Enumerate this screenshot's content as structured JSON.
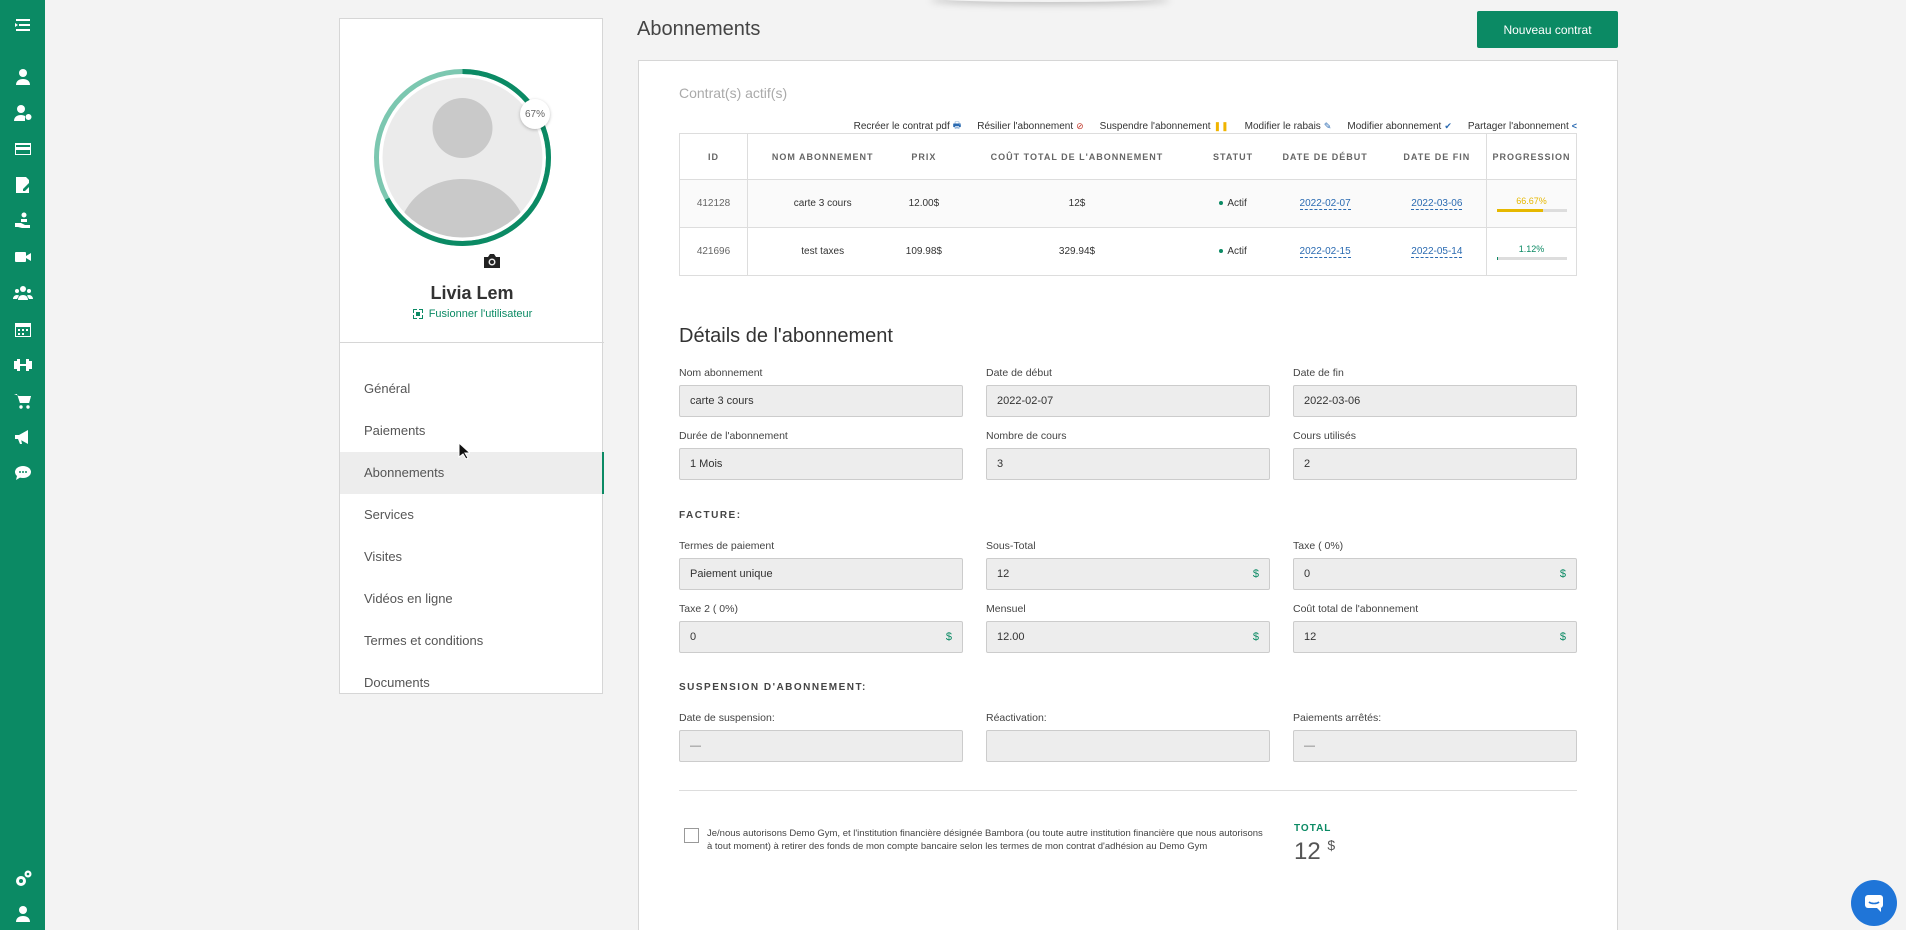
{
  "rail": {
    "icons": [
      "menu-icon",
      "user-icon",
      "user-settings-icon",
      "credit-card-icon",
      "contract-icon",
      "hand-icon",
      "video-icon",
      "group-icon",
      "calendar-icon",
      "dumbbell-icon",
      "cart-icon",
      "megaphone-icon",
      "chat-icon",
      "settings-icon",
      "account-icon"
    ]
  },
  "profile": {
    "name": "Livia Lem",
    "merge_label": "Fusionner l'utilisateur",
    "completion": "67%",
    "completion_value": 0.67
  },
  "nav": {
    "items": [
      "Général",
      "Paiements",
      "Abonnements",
      "Services",
      "Visites",
      "Vidéos en ligne",
      "Termes et conditions",
      "Documents"
    ],
    "active": "Abonnements"
  },
  "header": {
    "title": "Abonnements",
    "new_contract": "Nouveau contrat"
  },
  "active": {
    "title": "Contrat(s) actif(s)",
    "actions": [
      {
        "label": "Recréer le contrat pdf",
        "icon": "print-icon",
        "color": "#2a6ab1",
        "glyph": "🖶"
      },
      {
        "label": "Résilier l'abonnement",
        "icon": "cancel-icon",
        "color": "#c0392b",
        "glyph": "⊘"
      },
      {
        "label": "Suspendre l'abonnement",
        "icon": "pause-icon",
        "color": "#f0b400",
        "glyph": "❚❚"
      },
      {
        "label": "Modifier le rabais",
        "icon": "edit-icon",
        "color": "#2a6ab1",
        "glyph": "✎"
      },
      {
        "label": "Modifier abonnement",
        "icon": "check-icon",
        "color": "#2a6ab1",
        "glyph": "✔"
      },
      {
        "label": "Partager l'abonnement",
        "icon": "share-icon",
        "color": "#2a6ab1",
        "glyph": "<"
      }
    ],
    "columns": [
      "ID",
      "Nom abonnement",
      "Prix",
      "Coût total de l'abonnement",
      "Statut",
      "Date de début",
      "Date de fin",
      "Progression"
    ],
    "rows": [
      {
        "id": "412128",
        "name": "carte 3 cours",
        "price": "12.00$",
        "total": "12$",
        "status": "Actif",
        "start": "2022-02-07",
        "end": "2022-03-06",
        "progress": "66.67%",
        "progress_value": 0.6667,
        "progress_color": "#e6b800"
      },
      {
        "id": "421696",
        "name": "test taxes",
        "price": "109.98$",
        "total": "329.94$",
        "status": "Actif",
        "start": "2022-02-15",
        "end": "2022-05-14",
        "progress": "1.12%",
        "progress_value": 0.0112,
        "progress_color": "#0b8a64"
      }
    ]
  },
  "details": {
    "title": "Détails de l'abonnement",
    "name_label": "Nom abonnement",
    "name_value": "carte 3 cours",
    "start_label": "Date de début",
    "start_value": "2022-02-07",
    "end_label": "Date de fin",
    "end_value": "2022-03-06",
    "duration_label": "Durée de l'abonnement",
    "duration_value": "1 Mois",
    "courses_label": "Nombre de cours",
    "courses_value": "3",
    "used_label": "Cours utilisés",
    "used_value": "2"
  },
  "invoice": {
    "title": "FACTURE:",
    "terms_label": "Termes de paiement",
    "terms_value": "Paiement unique",
    "subtotal_label": "Sous-Total",
    "subtotal_value": "12",
    "tax_label": "Taxe ( 0%)",
    "tax_value": "0",
    "tax2_label": "Taxe 2 ( 0%)",
    "tax2_value": "0",
    "monthly_label": "Mensuel",
    "monthly_value": "12.00",
    "total_cost_label": "Coût total de l'abonnement",
    "total_cost_value": "12",
    "currency": "$"
  },
  "suspension": {
    "title": "SUSPENSION D'ABONNEMENT:",
    "date_label": "Date de suspension:",
    "date_value": "—",
    "reactivation_label": "Réactivation:",
    "reactivation_value": "",
    "stopped_label": "Paiements arrêtés:",
    "stopped_value": "—"
  },
  "authorization": {
    "text": "Je/nous autorisons Demo Gym, et l'institution financière désignée Bambora (ou toute autre institution financière que nous autorisons à tout moment) à retirer des fonds de mon compte bancaire selon les termes de mon contrat d'adhésion au Demo Gym"
  },
  "total": {
    "label": "TOTAL",
    "value": "12",
    "currency": "$"
  }
}
